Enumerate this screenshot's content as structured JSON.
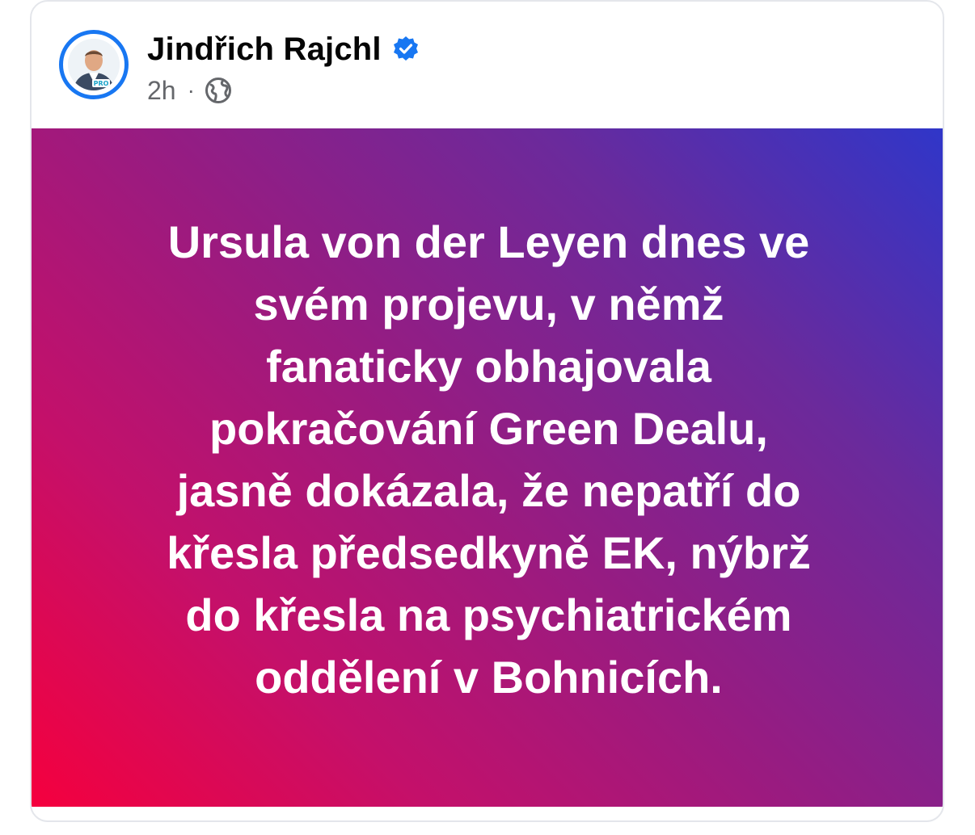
{
  "post": {
    "author_name": "Jindřich Rajchl",
    "timestamp": "2h",
    "separator": "·",
    "audience_icon": "globe-icon",
    "verified_icon": "verified-badge-icon",
    "avatar_badge_text": "PRO",
    "background_gradient": [
      "#f5003e",
      "#961c82",
      "#2f36c9"
    ],
    "body_text": "Ursula von der Leyen dnes ve\nsvém projevu, v němž\nfanaticky obhajovala\npokračování Green Dealu,\njasně dokázala, že nepatří do\nkřesla předsedkyně EK, nýbrž\ndo křesla na psychiatrickém\noddělení v Bohnicích."
  },
  "colors": {
    "verified_blue": "#1877f2",
    "name_text": "#050505",
    "meta_text": "#65676b",
    "post_text": "#ffffff"
  }
}
